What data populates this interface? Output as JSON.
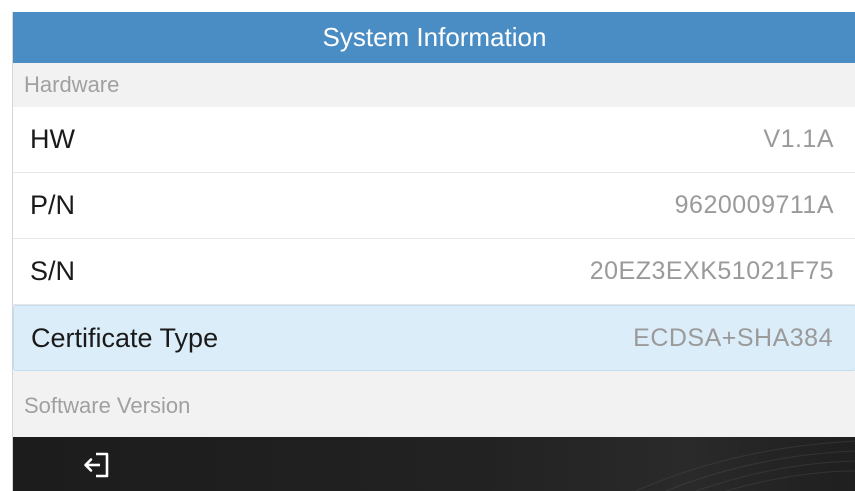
{
  "window": {
    "title": "System Information"
  },
  "sections": {
    "hardware_header": "Hardware",
    "software_header": "Software Version"
  },
  "hardware_rows": [
    {
      "label": "HW",
      "value": "V1.1A"
    },
    {
      "label": "P/N",
      "value": "9620009711A"
    },
    {
      "label": "S/N",
      "value": "20EZ3EXK51021F75"
    },
    {
      "label": "Certificate Type",
      "value": "ECDSA+SHA384",
      "selected": true
    }
  ],
  "bottom_bar": {
    "exit_icon": "exit-icon"
  },
  "colors": {
    "title_bar": "#4a8cc4",
    "selected_row": "#dcedfa",
    "value_text": "#9a9a9a",
    "bottom_bar": "#1c1c1c"
  }
}
